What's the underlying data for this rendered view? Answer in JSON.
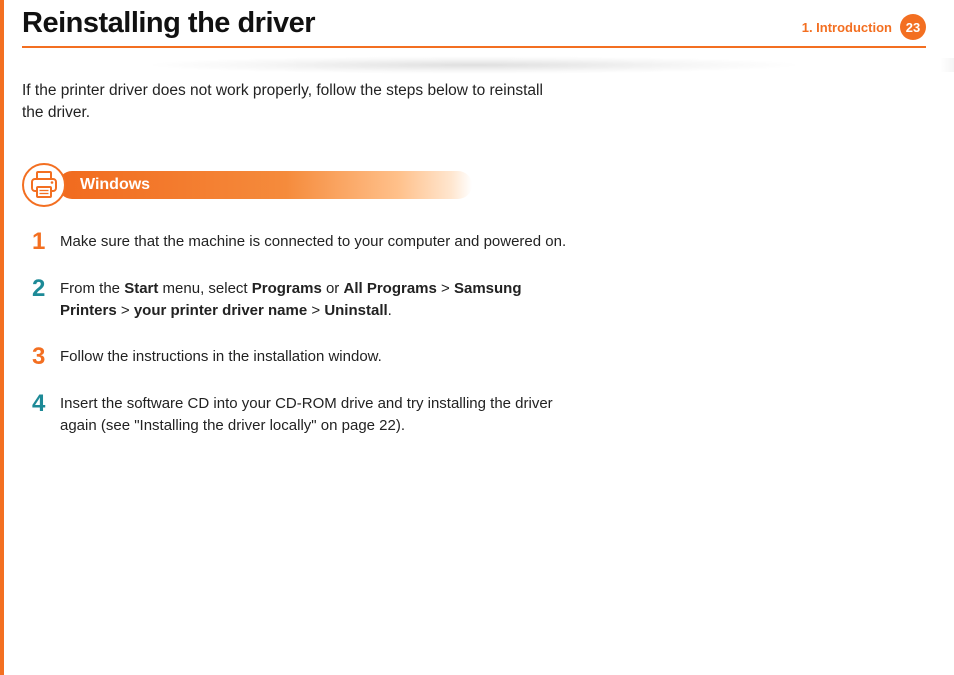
{
  "header": {
    "title": "Reinstalling the driver",
    "chapter_label": "1.  Introduction",
    "page_number": "23"
  },
  "intro": "If the printer driver does not work properly, follow the steps below to reinstall the driver.",
  "section": {
    "title": "Windows"
  },
  "steps": [
    {
      "num": "1",
      "color": "orange",
      "plain": "Make sure that the machine is connected to your computer and powered on."
    },
    {
      "num": "2",
      "color": "teal",
      "pre": "From the ",
      "b1": "Start",
      "mid1": " menu, select ",
      "b2": "Programs",
      "mid2": " or ",
      "b3": "All Programs",
      "gt1": " > ",
      "b4": "Samsung Printers",
      "gt2": " > ",
      "b5": "your printer driver name",
      "gt3": " > ",
      "b6": "Uninstall",
      "post": "."
    },
    {
      "num": "3",
      "color": "orange",
      "plain": "Follow the instructions in the installation window."
    },
    {
      "num": "4",
      "color": "teal",
      "plain": "Insert the software CD into your CD-ROM drive and try installing the driver again (see \"Installing the driver locally\" on page 22)."
    }
  ]
}
